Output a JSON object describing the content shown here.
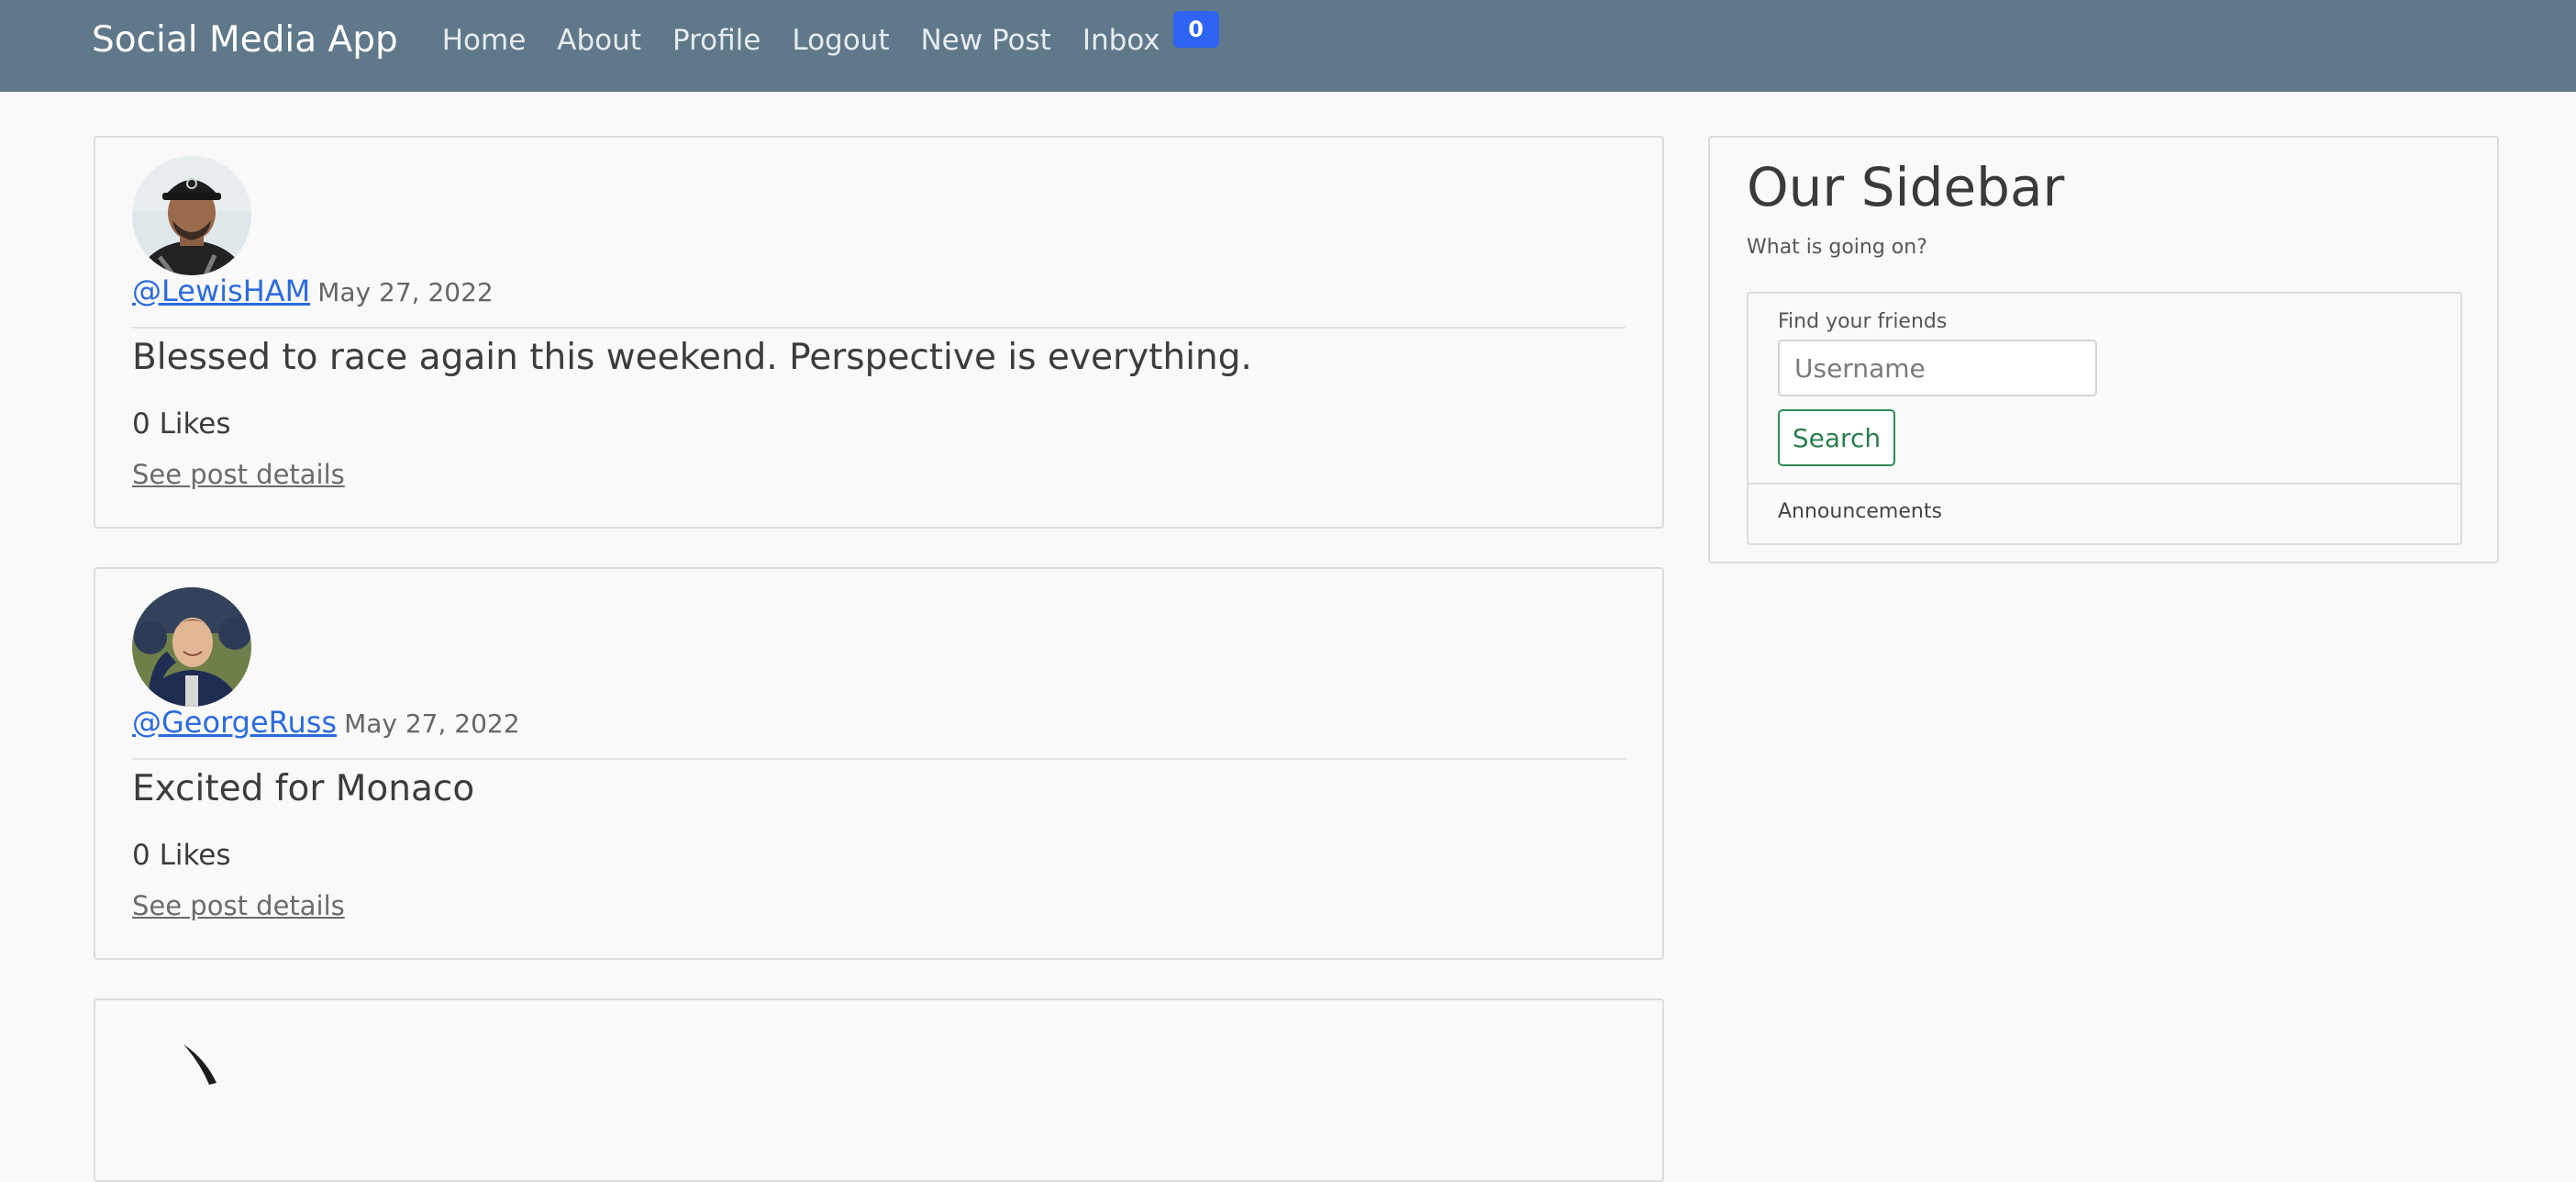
{
  "navbar": {
    "brand": "Social Media App",
    "items": [
      "Home",
      "About",
      "Profile",
      "Logout",
      "New Post",
      "Inbox"
    ],
    "inbox_badge": "0",
    "color": "#5f788a"
  },
  "posts": [
    {
      "handle": "@LewisHAM",
      "date": "May 27, 2022",
      "text": "Blessed to race again this weekend. Perspective is everything.",
      "likes": "0 Likes",
      "details_link": "See post details",
      "avatar_icon": "avatar-photo"
    },
    {
      "handle": "@GeorgeRuss",
      "date": "May 27, 2022",
      "text": "Excited for Monaco",
      "likes": "0 Likes",
      "details_link": "See post details",
      "avatar_icon": "avatar-photo"
    }
  ],
  "sidebar": {
    "title": "Our Sidebar",
    "subtitle": "What is going on?",
    "find_label": "Find your friends",
    "username_placeholder": "Username",
    "search_label": "Search",
    "announcements": "Announcements"
  },
  "colors": {
    "link": "#2c6bdd",
    "badge": "#2f63f3",
    "search_button": "#2e8b57"
  }
}
